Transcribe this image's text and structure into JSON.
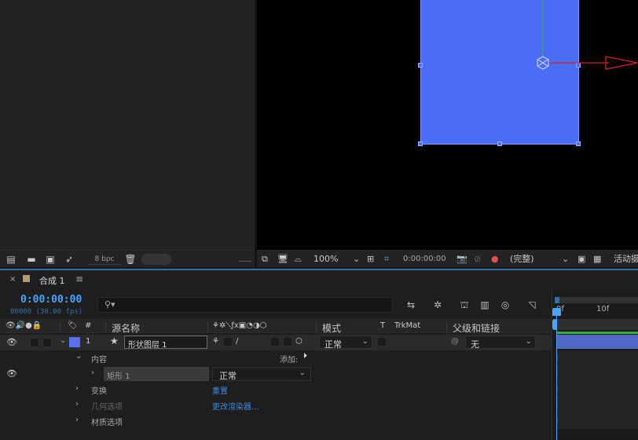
{
  "project": {
    "bpc": "8 bpc"
  },
  "viewer": {
    "zoom": "100%",
    "time": "0:00:00:00",
    "resolution": "(完整)",
    "active_camera": "活动摄"
  },
  "timeline": {
    "close": "×",
    "tab_name": "合成 1",
    "menu": "≡",
    "timecode": "0:00:00:00",
    "frame_info": "00000 (30.00 fps)",
    "search_placeholder": "",
    "columns": {
      "number": "#",
      "source_name": "源名称",
      "mode": "模式",
      "t": "T",
      "trkmat": "TrkMat",
      "parent": "父级和链接"
    },
    "layer": {
      "number": "1",
      "name": "形状图层 1",
      "mode": "正常",
      "parent": "无"
    },
    "content_label": "内容",
    "add_label": "添加:",
    "rect_name": "矩形 1",
    "rect_mode": "正常",
    "transform_label": "变换",
    "transform_link": "重置",
    "geometry_label": "几何选项",
    "geometry_link": "更改渲染器...",
    "material_label": "材质选项",
    "ruler": {
      "tick0": "0f",
      "tick10": "10f"
    }
  },
  "colors": {
    "accent": "#4aa3ff",
    "layer_fill": "#4a6cf7",
    "label": "#5b6ff0"
  }
}
